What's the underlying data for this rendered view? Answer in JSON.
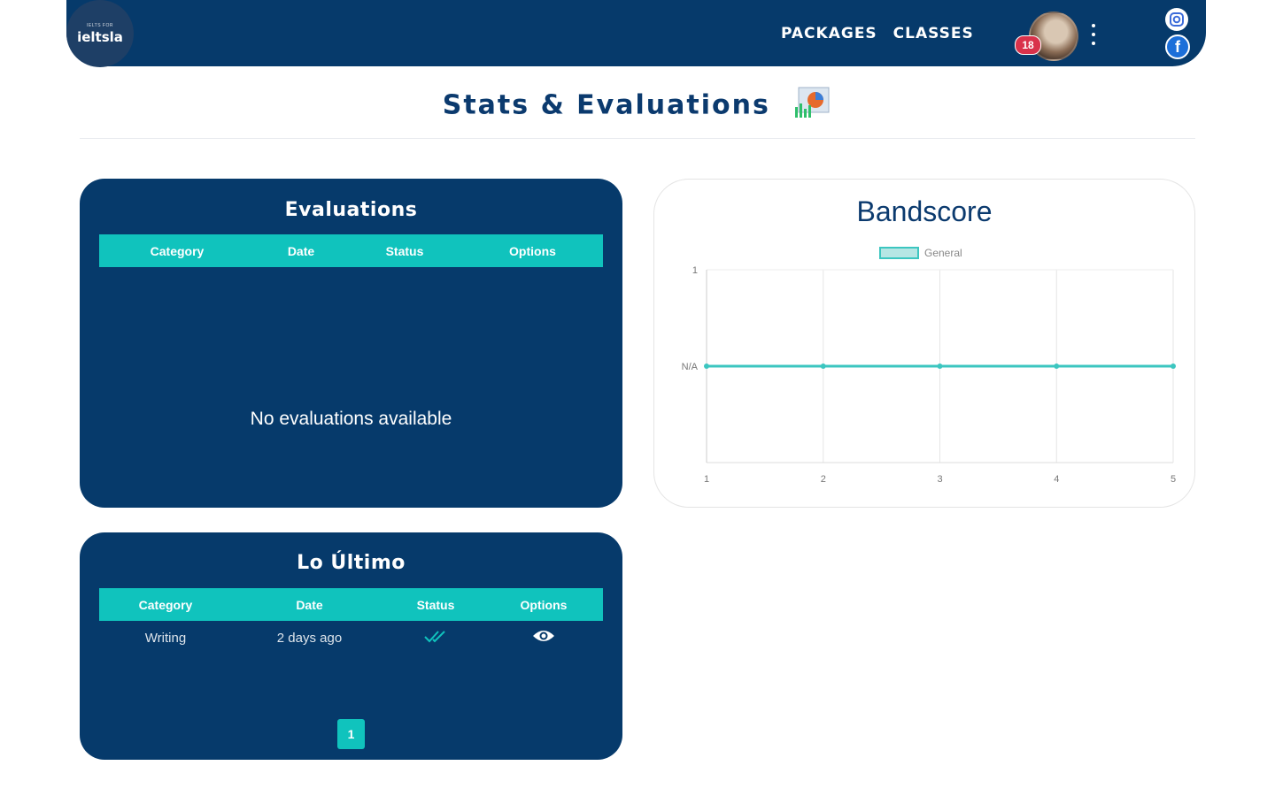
{
  "header": {
    "logo_small": "IELTS FOR",
    "logo_main": "ieltsla",
    "nav": [
      {
        "label": "Packages"
      },
      {
        "label": "Classes"
      }
    ],
    "notification_count": "18",
    "social": [
      "instagram-icon",
      "facebook-icon"
    ]
  },
  "page": {
    "title": "Stats & Evaluations"
  },
  "evaluations": {
    "title": "Evaluations",
    "columns": [
      "Category",
      "Date",
      "Status",
      "Options"
    ],
    "empty_message": "No evaluations available"
  },
  "latest": {
    "title": "Lo Último",
    "columns": [
      "Category",
      "Date",
      "Status",
      "Options"
    ],
    "rows": [
      {
        "category": "Writing",
        "date": "2 days ago",
        "status": "double-check-icon",
        "options": "eye-icon"
      }
    ],
    "page_current": "1"
  },
  "chart_data": {
    "type": "line",
    "title": "Bandscore",
    "x": [
      1,
      2,
      3,
      4,
      5
    ],
    "x_tick_labels": [
      "1",
      "2",
      "3",
      "4",
      "5"
    ],
    "y_tick_labels": [
      "1",
      "N/A"
    ],
    "series": [
      {
        "name": "General",
        "values": [
          "N/A",
          "N/A",
          "N/A",
          "N/A",
          "N/A"
        ],
        "color": "#3cc6c0"
      }
    ],
    "legend": "top-center",
    "grid": true
  },
  "colors": {
    "primary": "#063a6b",
    "accent": "#10c3bd",
    "badge": "#d9324b"
  }
}
